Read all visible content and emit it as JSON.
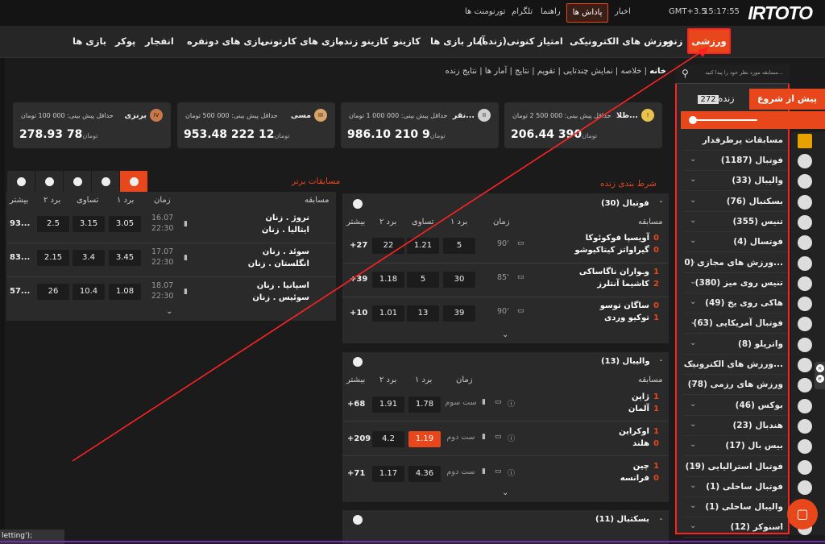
{
  "topbar": {
    "logo": "IRTOTO",
    "time": "15:17:55",
    "tz": "GMT+3.5",
    "news": "اخبار",
    "reward": "پاداش ها",
    "guide": "راهنما",
    "telegram": "تلگرام",
    "tournaments": "تورنومنت ها"
  },
  "nav": {
    "sport": "ورزشی",
    "live": "زنده",
    "esports": "ورزش های الکترونیکی",
    "live_points": "امتیاز کنونی(زنده)",
    "game_stats": "آمار بازی ها",
    "casino": "کازینو",
    "live_casino": "کازینو زنده",
    "cartoon": "بازی های کارتونی",
    "two_player": "بازی های دونفره",
    "crash": "انفجار",
    "poker": "پوکر",
    "games": "بازی ها"
  },
  "breadcrumb": {
    "home": "خانه",
    "summary": "خلاصه",
    "multiview": "نمایش چندتایی",
    "calendar": "تقویم",
    "results": "نتایج",
    "stats": "آمار ها",
    "live_results": "نتایج زنده"
  },
  "sidebar": {
    "search_placeholder": "مسابقه مورد نظر خود را پیدا کنید...",
    "tab_prematch": "پیش از شروع",
    "tab_live": "زنده",
    "tab_live_count": "272",
    "popular": "مسابقات پرطرفدار",
    "items": [
      {
        "label": "فوتبال (1187)"
      },
      {
        "label": "والیبال (33)"
      },
      {
        "label": "بسکتبال (76)"
      },
      {
        "label": "تنیس (355)"
      },
      {
        "label": "فوتسال (4)"
      },
      {
        "label": "ورزش های مجازی (0..."
      },
      {
        "label": "تنیس روی میز (380)"
      },
      {
        "label": "هاکی روی یخ (49)"
      },
      {
        "label": "فوتبال آمریکایی (63)"
      },
      {
        "label": "واترپلو (8)"
      },
      {
        "label": "ورزش های الکترونیک..."
      },
      {
        "label": "ورزش های رزمی (78)"
      },
      {
        "label": "بوکس (46)"
      },
      {
        "label": "هندبال (23)"
      },
      {
        "label": "بیس بال (17)"
      },
      {
        "label": "فوتبال استرالیایی (19)"
      },
      {
        "label": "فوتبال ساحلی (1)"
      },
      {
        "label": "والیبال ساحلی (1)"
      },
      {
        "label": "اسنوکر (12)"
      }
    ]
  },
  "cards": [
    {
      "name": "طلا...",
      "min": "حداقل پیش بینی: 000 500 2 تومان",
      "amount": "390 206.44",
      "currency": "تومان",
      "color": "#e8c24a",
      "badge": "!"
    },
    {
      "name": "نقر...",
      "min": "حداقل پیش بینی: 000 000 1 تومان",
      "amount": "9 210 986.10",
      "currency": "تومان",
      "color": "#cfcfcf",
      "badge": "II"
    },
    {
      "name": "مسی",
      "min": "حداقل پیش بینی: 000 500 تومان",
      "amount": "12 222 953.48",
      "currency": "تومان",
      "color": "#d9a36a",
      "badge": "III"
    },
    {
      "name": "برنزی",
      "min": "حداقل پیش بینی: 000 100 تومان",
      "amount": "78 278.93",
      "currency": "تومان",
      "color": "#c9784a",
      "badge": "IV"
    }
  ],
  "live_bets": {
    "title": "شرط بندی زنده",
    "headers": {
      "match": "مسابقه",
      "time": "زمان",
      "w1": "برد ۱",
      "draw": "تساوی",
      "w2": "برد ۲",
      "more": "بیشتر"
    },
    "football": {
      "label": "فوتبال (30)",
      "matches": [
        {
          "home": "آویسپا فوکوئوکا",
          "away": "گیراواتز کیتاکیوشو",
          "s1": "0",
          "s2": "0",
          "time": "90'",
          "w1": "5",
          "draw": "1.21",
          "w2": "22",
          "more": "+27"
        },
        {
          "home": "وـواران ناگاساکی",
          "away": "کاشیما آنتلرز",
          "s1": "1",
          "s2": "2",
          "time": "85'",
          "w1": "30",
          "draw": "5",
          "w2": "1.18",
          "more": "+39"
        },
        {
          "home": "ساگان توسو",
          "away": "توکیو وردی",
          "s1": "0",
          "s2": "1",
          "time": "90'",
          "w1": "39",
          "draw": "13",
          "w2": "1.01",
          "more": "+10"
        }
      ]
    },
    "volleyball": {
      "label": "والیبال (13)",
      "headers": {
        "match": "مسابقه",
        "time": "زمان",
        "w1": "برد ۱",
        "w2": "برد ۲",
        "more": "بیشتر"
      },
      "matches": [
        {
          "home": "ژاپن",
          "away": "آلمان",
          "s1": "1",
          "s2": "1",
          "time": "ست سوم",
          "w1": "1.78",
          "w2": "1.91",
          "more": "+68",
          "hi": false
        },
        {
          "home": "اوکراین",
          "away": "هلند",
          "s1": "1",
          "s2": "0",
          "time": "ست دوم",
          "w1": "1.19",
          "w2": "4.2",
          "more": "+209",
          "hi": true
        },
        {
          "home": "چین",
          "away": "فرانسه",
          "s1": "1",
          "s2": "0",
          "time": "ست دوم",
          "w1": "4.36",
          "w2": "1.17",
          "more": "+71",
          "hi": false
        }
      ]
    },
    "basketball": {
      "label": "بسکتبال (11)"
    }
  },
  "top_matches": {
    "title": "مسابقات برتر",
    "headers": {
      "match": "مسابقه",
      "time": "زمان",
      "w1": "برد ۱",
      "draw": "تساوی",
      "w2": "برد ۲",
      "more": "بیشتر"
    },
    "matches": [
      {
        "home": "نروژ . زنان",
        "away": "ایتالیا . زنان",
        "date": "16.07",
        "clock": "22:30",
        "w1": "3.05",
        "draw": "3.15",
        "w2": "2.5",
        "more": "93..."
      },
      {
        "home": "سوئد . زنان",
        "away": "انگلستان . زنان",
        "date": "17.07",
        "clock": "22:30",
        "w1": "3.45",
        "draw": "3.4",
        "w2": "2.15",
        "more": "83..."
      },
      {
        "home": "اسپانیا . زنان",
        "away": "سوئیس . زنان",
        "date": "18.07",
        "clock": "22:30",
        "w1": "1.08",
        "draw": "10.4",
        "w2": "26",
        "more": "57..."
      }
    ]
  },
  "bottom_text": "letting');",
  "colors": {
    "accent": "#e8471b",
    "annotation": "#ff2222"
  }
}
